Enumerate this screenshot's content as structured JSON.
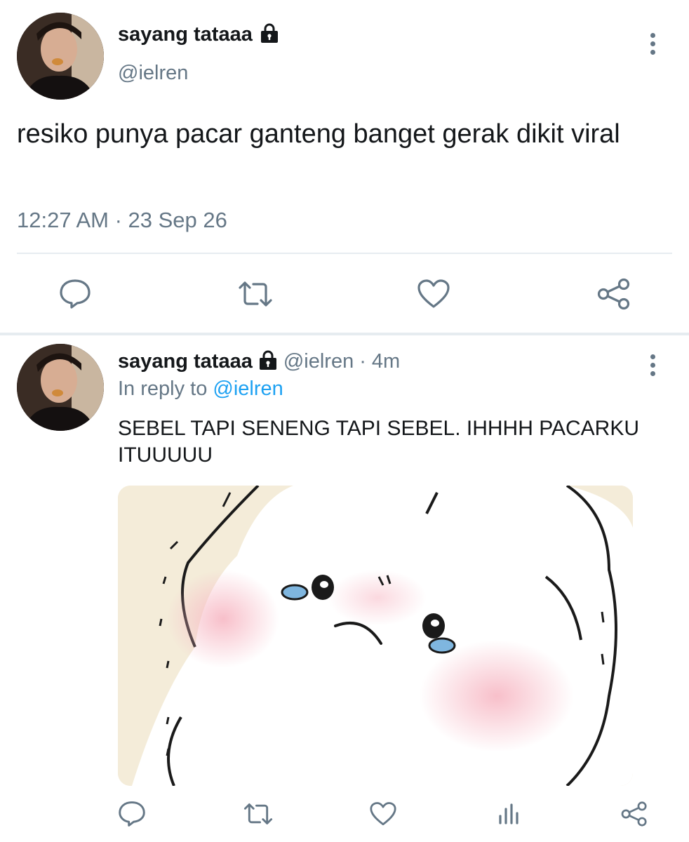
{
  "tweet_main": {
    "display_name": "sayang tataaa",
    "handle": "@ielren",
    "text": "resiko punya pacar ganteng banget gerak dikit viral",
    "timestamp": "12:27 AM · 23 Sep 26",
    "actions": [
      "comment-icon",
      "retweet-icon",
      "like-icon",
      "share-icon"
    ]
  },
  "tweet_reply": {
    "display_name": "sayang tataaa",
    "handle": "@ielren",
    "separator": "·",
    "time_ago": "4m",
    "reply_prefix": "In reply to",
    "reply_to": "@ielren",
    "text": "SEBEL TAPI SENENG TAPI SEBEL. IHHHH PACARKU ITUUUUU",
    "actions": [
      "comment-icon",
      "retweet-icon",
      "like-icon",
      "analytics-icon",
      "share-icon"
    ]
  },
  "colors": {
    "text": "#14171a",
    "secondary": "#657786",
    "link": "#1da1f2",
    "divider": "#e6ecf0"
  }
}
